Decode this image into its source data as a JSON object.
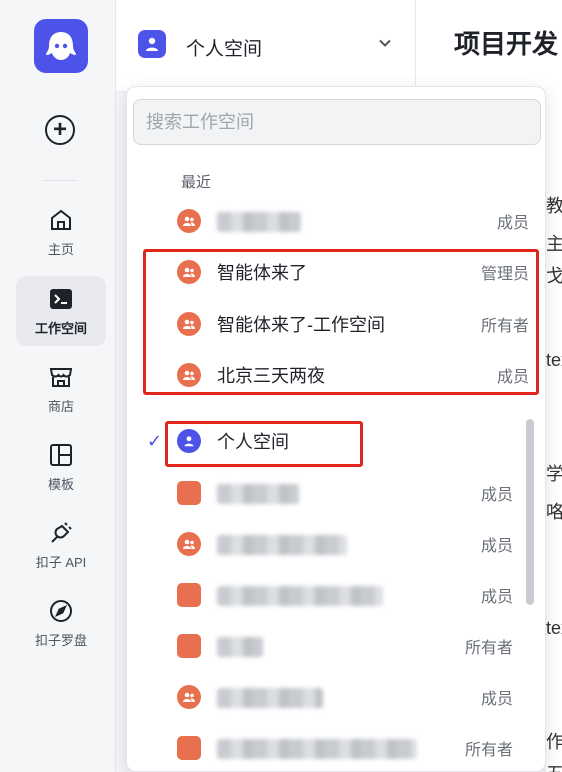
{
  "sidebar": {
    "items": [
      {
        "label": "主页",
        "icon": "home-icon"
      },
      {
        "label": "工作空间",
        "icon": "terminal-icon",
        "active": true
      },
      {
        "label": "商店",
        "icon": "store-icon"
      },
      {
        "label": "模板",
        "icon": "template-icon"
      },
      {
        "label": "扣子 API",
        "icon": "plug-icon"
      },
      {
        "label": "扣子罗盘",
        "icon": "compass-icon"
      }
    ]
  },
  "header": {
    "workspace_name": "个人空间",
    "page_title": "项目开发"
  },
  "dropdown": {
    "search_placeholder": "搜索工作空间",
    "recent_label": "最近",
    "recent": [
      {
        "name": "",
        "role": "成员",
        "blurred": true
      },
      {
        "name": "智能体来了",
        "role": "管理员"
      },
      {
        "name": "智能体来了-工作空间",
        "role": "所有者"
      },
      {
        "name": "北京三天两夜",
        "role": "成员"
      }
    ],
    "all": [
      {
        "name": "个人空间",
        "role": "",
        "selected": true
      },
      {
        "name": "",
        "role": "成员",
        "blurred": true
      },
      {
        "name": "",
        "role": "成员",
        "blurred": true
      },
      {
        "name": "",
        "role": "成员",
        "blurred": true
      },
      {
        "name": "",
        "role": "所有者",
        "blurred": true
      },
      {
        "name": "",
        "role": "成员",
        "blurred": true
      },
      {
        "name": "",
        "role": "所有者",
        "blurred": true
      }
    ]
  },
  "background_fragments": [
    "教",
    "主",
    "戈",
    "tex",
    "学",
    "咯",
    "tex",
    "作",
    "五"
  ],
  "colors": {
    "brand": "#4d53e8",
    "team_avatar": "#e8704f",
    "highlight": "#e0261a",
    "check": "#4d53e8"
  }
}
